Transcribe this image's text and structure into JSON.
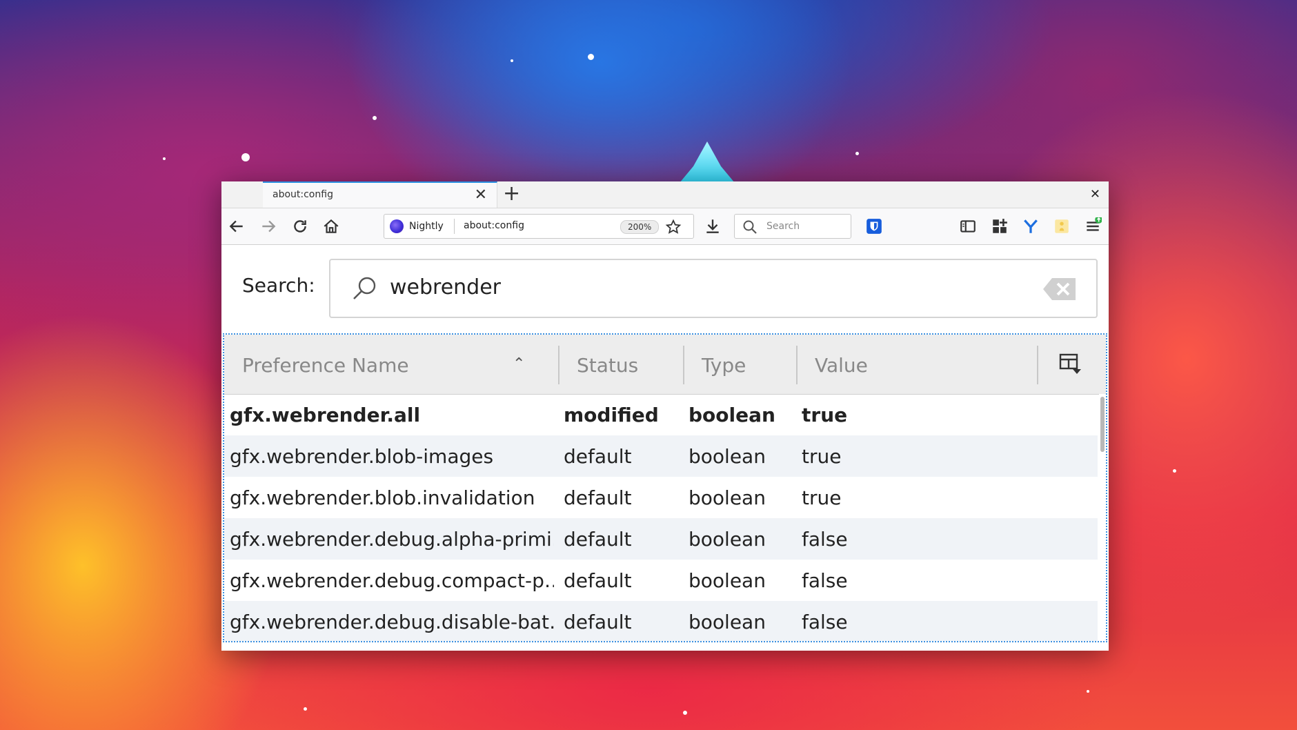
{
  "tab": {
    "title": "about:config"
  },
  "navbar": {
    "identity_label": "Nightly",
    "url": "about:config",
    "zoom": "200%",
    "search_placeholder": "Search"
  },
  "icons": {
    "back": "back-arrow-icon",
    "forward": "forward-arrow-icon",
    "reload": "reload-icon",
    "home": "home-icon",
    "bookmark": "star-icon",
    "downloads": "download-icon",
    "bitwarden": "bitwarden-shield-icon",
    "sidebar": "sidebar-icon",
    "extensions": "add-ons-grid-icon",
    "pocket": "y-extension-icon",
    "yellow": "yellow-extension-icon",
    "menu": "hamburger-menu-icon"
  },
  "config": {
    "search_label": "Search:",
    "search_value": "webrender",
    "columns": [
      "Preference Name",
      "Status",
      "Type",
      "Value"
    ],
    "rows": [
      {
        "name": "gfx.webrender.all",
        "status": "modified",
        "type": "boolean",
        "value": "true"
      },
      {
        "name": "gfx.webrender.blob-images",
        "status": "default",
        "type": "boolean",
        "value": "true"
      },
      {
        "name": "gfx.webrender.blob.invalidation",
        "status": "default",
        "type": "boolean",
        "value": "true"
      },
      {
        "name": "gfx.webrender.debug.alpha-primi…",
        "status": "default",
        "type": "boolean",
        "value": "false"
      },
      {
        "name": "gfx.webrender.debug.compact-p…",
        "status": "default",
        "type": "boolean",
        "value": "false"
      },
      {
        "name": "gfx.webrender.debug.disable-bat…",
        "status": "default",
        "type": "boolean",
        "value": "false"
      }
    ]
  },
  "colors": {
    "accent": "#2b8fe0",
    "tab_bg": "#f2f2f2",
    "row_alt": "#f0f3f7"
  }
}
